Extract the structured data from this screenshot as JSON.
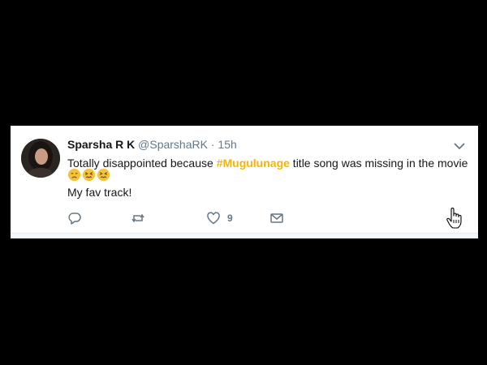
{
  "tweet": {
    "display_name": "Sparsha R K",
    "handle": "@SparshaRK",
    "separator": "·",
    "time": "15h",
    "text_before": "Totally disappointed because ",
    "hashtag": "#Mugulunage",
    "text_after": " title song was missing in the movie",
    "second_line": "My fav track!",
    "emojis": [
      "disappointed-face",
      "confounded-face",
      "confounded-face"
    ],
    "like_count": "9"
  },
  "colors": {
    "hashtag": "#f7b500",
    "icon": "#657786",
    "emoji": "#f5c33b"
  },
  "icons": {
    "reply": "reply-icon",
    "retweet": "retweet-icon",
    "like": "heart-icon",
    "dm": "envelope-icon",
    "menu": "chevron-down-icon",
    "cursor": "hand-cursor-icon"
  }
}
